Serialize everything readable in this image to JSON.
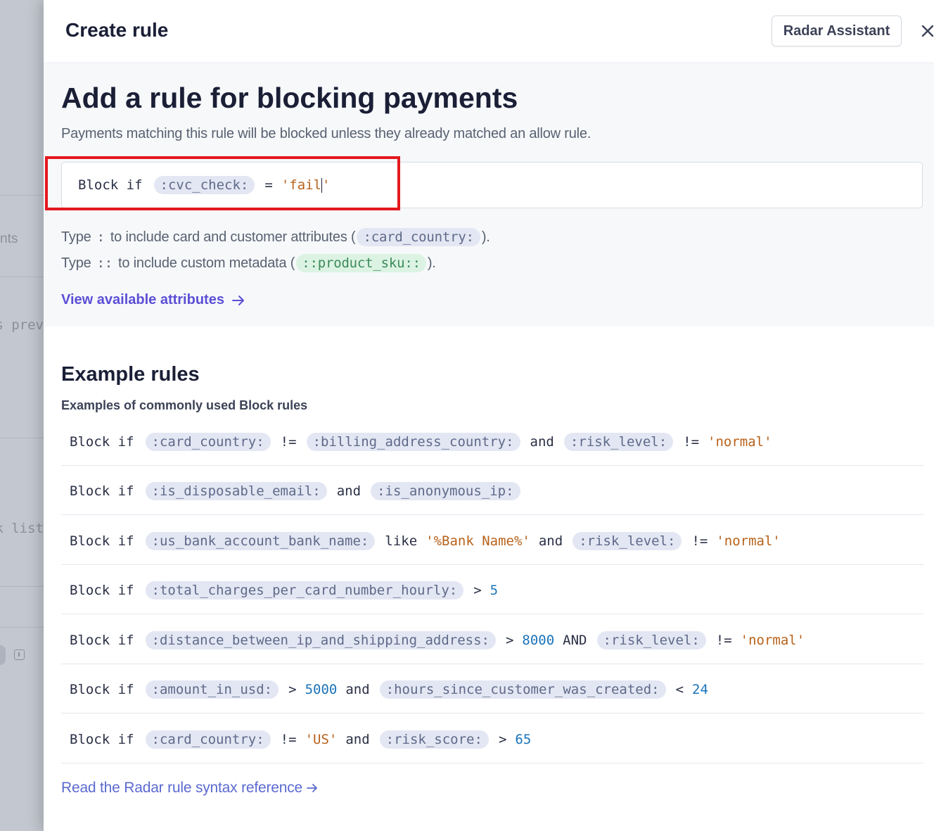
{
  "background": {
    "fragments": [
      "nts",
      "ts prev",
      "k list"
    ]
  },
  "modal": {
    "title": "Create rule",
    "assistant_label": "Radar Assistant"
  },
  "editor": {
    "heading": "Add a rule for blocking payments",
    "subtitle": "Payments matching this rule will be blocked unless they already matched an allow rule.",
    "rule_keyword": "Block if",
    "rule_attr": ":cvc_check:",
    "rule_op": "=",
    "rule_value_typed": "'fail",
    "rule_value_rest": "'"
  },
  "hints": {
    "type_word": "Type",
    "attr_symbol": ":",
    "attr_text": "to include card and customer attributes (",
    "attr_example": ":card_country:",
    "meta_symbol": "::",
    "meta_text": "to include custom metadata (",
    "meta_example": "::product_sku::",
    "close_paren": ")."
  },
  "view_attributes_label": "View available attributes",
  "examples": {
    "heading": "Example rules",
    "subtitle": "Examples of commonly used Block rules",
    "rows": [
      [
        {
          "t": "kw",
          "v": "Block if"
        },
        {
          "t": "attr",
          "v": ":card_country:"
        },
        {
          "t": "op",
          "v": "!="
        },
        {
          "t": "attr",
          "v": ":billing_address_country:"
        },
        {
          "t": "op",
          "v": "and"
        },
        {
          "t": "attr",
          "v": ":risk_level:"
        },
        {
          "t": "op",
          "v": "!="
        },
        {
          "t": "str",
          "v": "'normal'"
        }
      ],
      [
        {
          "t": "kw",
          "v": "Block if"
        },
        {
          "t": "attr",
          "v": ":is_disposable_email:"
        },
        {
          "t": "op",
          "v": "and"
        },
        {
          "t": "attr",
          "v": ":is_anonymous_ip:"
        }
      ],
      [
        {
          "t": "kw",
          "v": "Block if"
        },
        {
          "t": "attr",
          "v": ":us_bank_account_bank_name:"
        },
        {
          "t": "op",
          "v": "like"
        },
        {
          "t": "str",
          "v": "'%Bank Name%'"
        },
        {
          "t": "op",
          "v": "and"
        },
        {
          "t": "attr",
          "v": ":risk_level:"
        },
        {
          "t": "op",
          "v": "!="
        },
        {
          "t": "str",
          "v": "'normal'"
        }
      ],
      [
        {
          "t": "kw",
          "v": "Block if"
        },
        {
          "t": "attr",
          "v": ":total_charges_per_card_number_hourly:"
        },
        {
          "t": "op",
          "v": ">"
        },
        {
          "t": "num",
          "v": "5"
        }
      ],
      [
        {
          "t": "kw",
          "v": "Block if"
        },
        {
          "t": "attr",
          "v": ":distance_between_ip_and_shipping_address:"
        },
        {
          "t": "op",
          "v": ">"
        },
        {
          "t": "num",
          "v": "8000"
        },
        {
          "t": "op",
          "v": "AND"
        },
        {
          "t": "attr",
          "v": ":risk_level:"
        },
        {
          "t": "op",
          "v": "!="
        },
        {
          "t": "str",
          "v": "'normal'"
        }
      ],
      [
        {
          "t": "kw",
          "v": "Block if"
        },
        {
          "t": "attr",
          "v": ":amount_in_usd:"
        },
        {
          "t": "op",
          "v": ">"
        },
        {
          "t": "num",
          "v": "5000"
        },
        {
          "t": "op",
          "v": "and"
        },
        {
          "t": "attr",
          "v": ":hours_since_customer_was_created:"
        },
        {
          "t": "op",
          "v": "<"
        },
        {
          "t": "num",
          "v": "24"
        }
      ],
      [
        {
          "t": "kw",
          "v": "Block if"
        },
        {
          "t": "attr",
          "v": ":card_country:"
        },
        {
          "t": "op",
          "v": "!="
        },
        {
          "t": "str",
          "v": "'US'"
        },
        {
          "t": "op",
          "v": "and"
        },
        {
          "t": "attr",
          "v": ":risk_score:"
        },
        {
          "t": "op",
          "v": ">"
        },
        {
          "t": "num",
          "v": "65"
        }
      ]
    ]
  },
  "syntax_reference_label": "Read the Radar rule syntax reference",
  "colors": {
    "accent": "#5b4fd6",
    "highlight": "#e3191e",
    "string": "#b8621b",
    "number": "#1a73b8",
    "attr_pill": "#e3e7f3",
    "meta_pill": "#dcf3e3"
  },
  "icons": {
    "close": "close-icon",
    "arrow": "arrow-right-icon",
    "info": "info-icon"
  }
}
